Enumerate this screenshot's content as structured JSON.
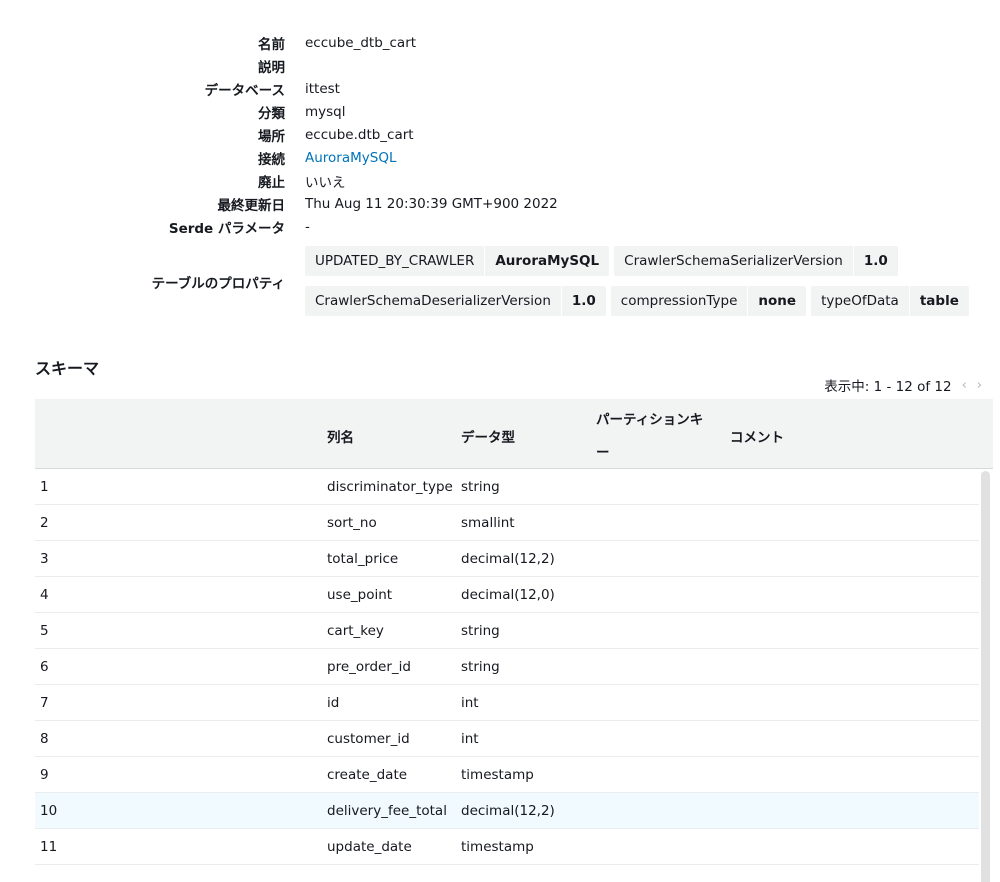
{
  "properties": [
    {
      "label": "名前",
      "value": "eccube_dtb_cart"
    },
    {
      "label": "説明",
      "value": ""
    },
    {
      "label": "データベース",
      "value": "ittest"
    },
    {
      "label": "分類",
      "value": "mysql"
    },
    {
      "label": "場所",
      "value": "eccube.dtb_cart"
    },
    {
      "label": "接続",
      "value": "AuroraMySQL"
    },
    {
      "label": "廃止",
      "value": "いいえ"
    },
    {
      "label": "最終更新日",
      "value": "Thu Aug 11 20:30:39 GMT+900 2022"
    },
    {
      "label": "Serde パラメータ",
      "value": "-"
    }
  ],
  "table_properties": {
    "label": "テーブルのプロパティ",
    "items": [
      {
        "key": "UPDATED_BY_CRAWLER",
        "value": "AuroraMySQL"
      },
      {
        "key": "CrawlerSchemaSerializerVersion",
        "value": "1.0"
      },
      {
        "key": "CrawlerSchemaDeserializerVersion",
        "value": "1.0"
      },
      {
        "key": "compressionType",
        "value": "none"
      },
      {
        "key": "typeOfData",
        "value": "table"
      }
    ]
  },
  "schema": {
    "title": "スキーマ",
    "pager": "表示中: 1 - 12 of 12",
    "pager_prev_icon": "‹",
    "pager_next_icon": "›",
    "headers": {
      "num": "",
      "column": "列名",
      "type": "データ型",
      "partition_key_line1": "パーティションキ",
      "partition_key_line2": "ー",
      "comment": "コメント"
    },
    "rows": [
      {
        "num": "1",
        "column": "discriminator_type",
        "type": "string",
        "partition": "",
        "comment": ""
      },
      {
        "num": "2",
        "column": "sort_no",
        "type": "smallint",
        "partition": "",
        "comment": ""
      },
      {
        "num": "3",
        "column": "total_price",
        "type": "decimal(12,2)",
        "partition": "",
        "comment": ""
      },
      {
        "num": "4",
        "column": "use_point",
        "type": "decimal(12,0)",
        "partition": "",
        "comment": ""
      },
      {
        "num": "5",
        "column": "cart_key",
        "type": "string",
        "partition": "",
        "comment": ""
      },
      {
        "num": "6",
        "column": "pre_order_id",
        "type": "string",
        "partition": "",
        "comment": ""
      },
      {
        "num": "7",
        "column": "id",
        "type": "int",
        "partition": "",
        "comment": ""
      },
      {
        "num": "8",
        "column": "customer_id",
        "type": "int",
        "partition": "",
        "comment": ""
      },
      {
        "num": "9",
        "column": "create_date",
        "type": "timestamp",
        "partition": "",
        "comment": ""
      },
      {
        "num": "10",
        "column": "delivery_fee_total",
        "type": "decimal(12,2)",
        "partition": "",
        "comment": ""
      },
      {
        "num": "11",
        "column": "update_date",
        "type": "timestamp",
        "partition": "",
        "comment": ""
      }
    ],
    "highlighted_row": "10"
  },
  "colors": {
    "link": "#0073bb",
    "header_bg": "#f2f3f3",
    "highlight_bg": "#f1faff"
  }
}
